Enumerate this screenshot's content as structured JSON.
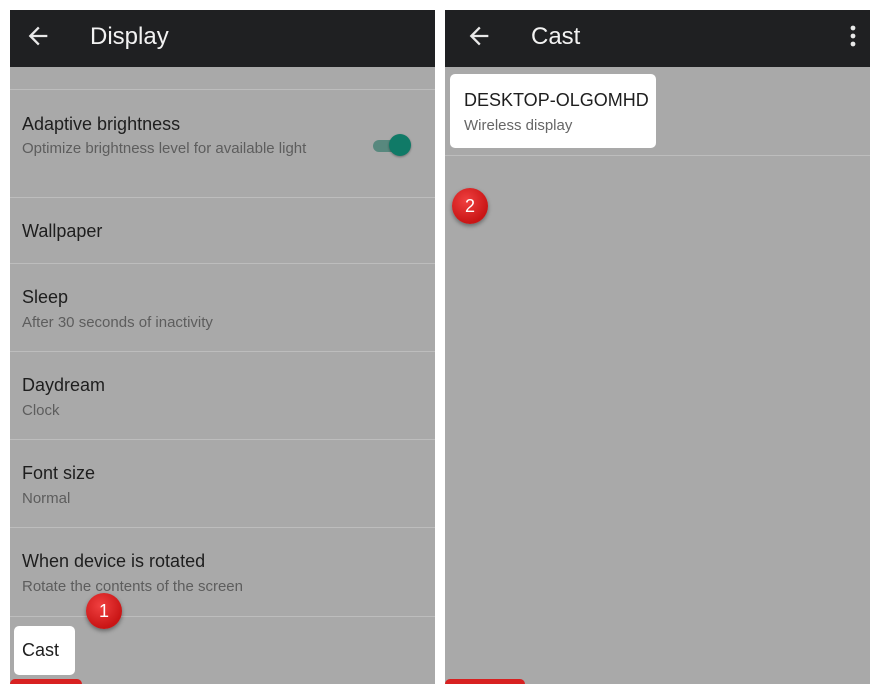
{
  "left": {
    "title": "Display",
    "items": [
      {
        "title": "Adaptive brightness",
        "subtitle": "Optimize brightness level for available light"
      },
      {
        "title": "Wallpaper"
      },
      {
        "title": "Sleep",
        "subtitle": "After 30 seconds of inactivity"
      },
      {
        "title": "Daydream",
        "subtitle": "Clock"
      },
      {
        "title": "Font size",
        "subtitle": "Normal"
      },
      {
        "title": "When device is rotated",
        "subtitle": "Rotate the contents of the screen"
      }
    ],
    "adaptive_toggle": "on",
    "cast_label": "Cast",
    "step_badge": "1"
  },
  "right": {
    "title": "Cast",
    "device": {
      "name": "DESKTOP-OLGOMHD",
      "type": "Wireless display"
    },
    "step_badge": "2"
  },
  "colors": {
    "appbar": "#1f2022",
    "dim_overlay": "#a9a9a9",
    "toggle_accent": "#107a67",
    "badge_red": "#d82121"
  },
  "icons": {
    "back": "arrow-left-icon",
    "overflow": "more-vert-icon"
  }
}
